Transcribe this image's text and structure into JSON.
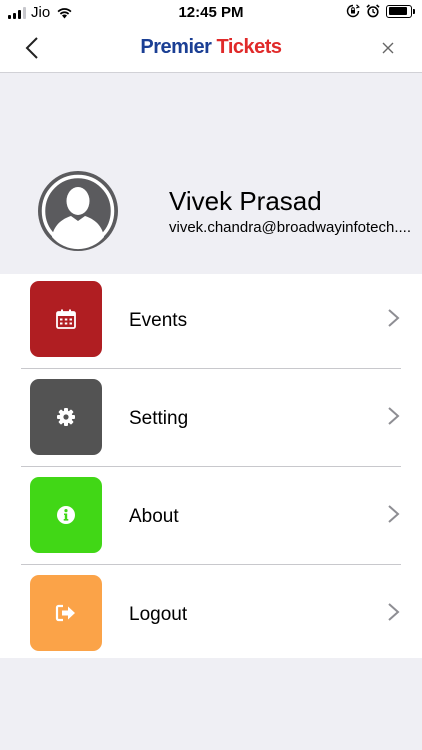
{
  "status_bar": {
    "carrier": "Jio",
    "time": "12:45 PM",
    "battery_level": 0.85,
    "icons": [
      "signal-icon",
      "wifi-icon",
      "rotation-lock-icon",
      "alarm-icon",
      "battery-icon"
    ]
  },
  "nav": {
    "brand_first": "Premier",
    "brand_second": "Tickets",
    "back_icon": "chevron-left-icon",
    "close_icon": "close-icon",
    "brand_colors": {
      "premier": "#1b3f94",
      "tickets": "#e02a2a"
    }
  },
  "profile": {
    "name": "Vivek Prasad",
    "email": "vivek.chandra@broadwayinfotech....",
    "avatar_icon": "user-avatar-icon"
  },
  "menu": {
    "items": [
      {
        "label": "Events",
        "icon": "calendar-icon",
        "color": "#b01e22"
      },
      {
        "label": "Setting",
        "icon": "gear-icon",
        "color": "#535353"
      },
      {
        "label": "About",
        "icon": "info-icon",
        "color": "#41d716"
      },
      {
        "label": "Logout",
        "icon": "logout-icon",
        "color": "#fba348"
      }
    ],
    "chevron_icon": "chevron-right-icon"
  }
}
